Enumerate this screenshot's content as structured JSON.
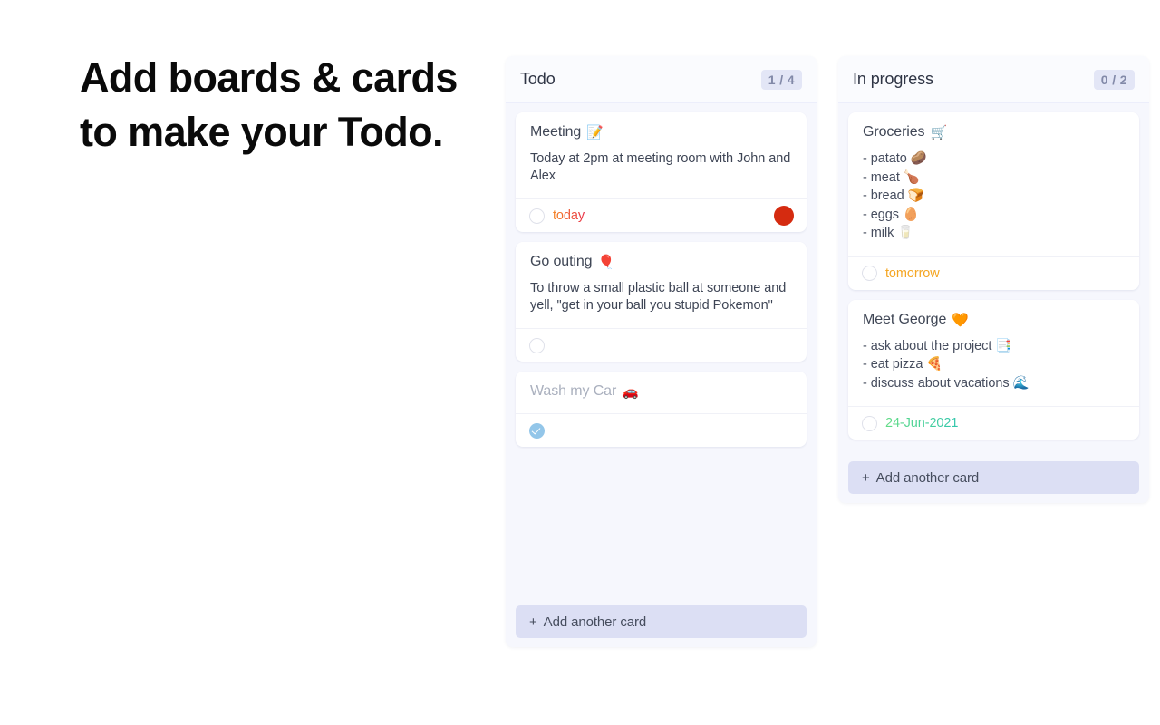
{
  "headline": {
    "lead": "Add",
    "rest": " boards & cards to make your Todo."
  },
  "colors": {
    "column_bg": "#f6f7fd",
    "badge_bg": "#e3e6f6",
    "badge_text": "#8289a8",
    "add_card_bg": "#dcdff4",
    "due_today_from": "#f58320",
    "due_today_to": "#e8334a",
    "due_tomorrow": "#f5a623",
    "due_date_from": "#63dc86",
    "due_date_to": "#33c6ad",
    "dot_red": "#d52b10",
    "check_done": "#93c6e9"
  },
  "columns": [
    {
      "id": "todo",
      "title": "Todo",
      "badge": "1 / 4",
      "add_label": "Add another card",
      "add_plus": "+",
      "cards": [
        {
          "id": "meeting",
          "title": "Meeting",
          "emoji": "📝",
          "emoji_name": "memo-icon",
          "desc": "Today at 2pm at meeting room with John and Alex",
          "done": false,
          "due": "today",
          "due_kind": "today",
          "dot": true
        },
        {
          "id": "go-outing",
          "title": "Go outing",
          "emoji": "🎈",
          "emoji_name": "balloon-icon",
          "desc": "To throw a small plastic ball at someone and yell, \"get in your ball you stupid Pokemon\"",
          "done": false,
          "due": "",
          "due_kind": "",
          "dot": false
        },
        {
          "id": "wash-my-car",
          "title": "Wash my Car",
          "emoji": "🚗",
          "emoji_name": "car-icon",
          "desc": "",
          "done": true,
          "due": "",
          "due_kind": "",
          "dot": false
        }
      ]
    },
    {
      "id": "in-progress",
      "title": "In progress",
      "badge": "0 / 2",
      "add_label": "Add another card",
      "add_plus": "+",
      "cards": [
        {
          "id": "groceries",
          "title": "Groceries",
          "emoji": "🛒",
          "emoji_name": "shopping-cart-icon",
          "list": [
            "- patato 🥔",
            "- meat 🍗",
            "- bread 🍞",
            "- eggs 🥚",
            "- milk 🥛"
          ],
          "done": false,
          "due": "tomorrow",
          "due_kind": "tomorrow",
          "dot": false
        },
        {
          "id": "meet-george",
          "title": "Meet George",
          "emoji": "🧡",
          "emoji_name": "orange-heart-icon",
          "list": [
            "- ask about the project 📑",
            "- eat pizza 🍕",
            "- discuss about vacations 🌊"
          ],
          "done": false,
          "due": "24-Jun-2021",
          "due_kind": "date",
          "dot": false
        }
      ]
    }
  ]
}
